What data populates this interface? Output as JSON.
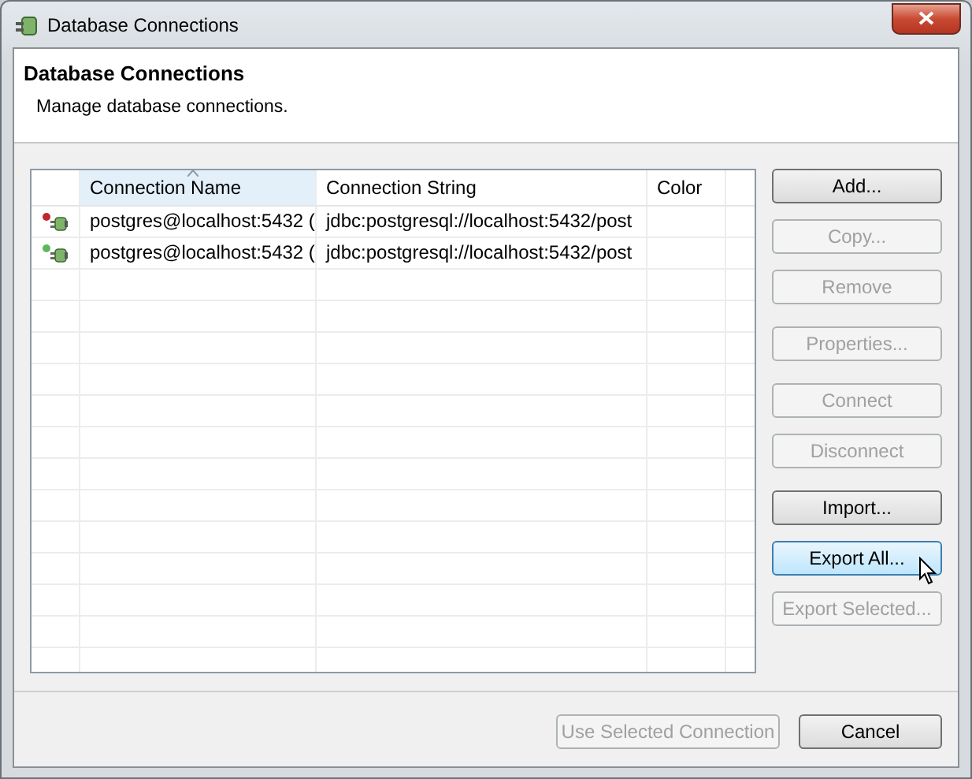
{
  "window": {
    "title": "Database Connections"
  },
  "header": {
    "title": "Database Connections",
    "description": "Manage database connections."
  },
  "table": {
    "columns": [
      {
        "label": "Connection Name",
        "sorted": true
      },
      {
        "label": "Connection String",
        "sorted": false
      },
      {
        "label": "Color",
        "sorted": false
      }
    ],
    "rows": [
      {
        "color": "#c0262c",
        "cells": [
          "postgres@localhost:5432 (",
          "jdbc:postgresql://localhost:5432/post"
        ]
      },
      {
        "color": "#5cb85c",
        "cells": [
          "postgres@localhost:5432 (",
          "jdbc:postgresql://localhost:5432/post"
        ]
      }
    ]
  },
  "button_groups": [
    [
      {
        "label": "Add...",
        "disabled": false,
        "hovered": false
      },
      {
        "label": "Copy...",
        "disabled": true,
        "hovered": false
      },
      {
        "label": "Remove",
        "disabled": true,
        "hovered": false
      }
    ],
    [
      {
        "label": "Properties...",
        "disabled": true,
        "hovered": false
      }
    ],
    [
      {
        "label": "Connect",
        "disabled": true,
        "hovered": false
      },
      {
        "label": "Disconnect",
        "disabled": true,
        "hovered": false
      }
    ],
    [
      {
        "label": "Import...",
        "disabled": false,
        "hovered": false
      },
      {
        "label": "Export All...",
        "disabled": false,
        "hovered": true
      },
      {
        "label": "Export Selected...",
        "disabled": true,
        "hovered": false
      }
    ]
  ],
  "footer_buttons": [
    {
      "label": "Use Selected Connection",
      "disabled": true,
      "hovered": false
    },
    {
      "label": "Cancel",
      "disabled": false,
      "hovered": false
    }
  ]
}
